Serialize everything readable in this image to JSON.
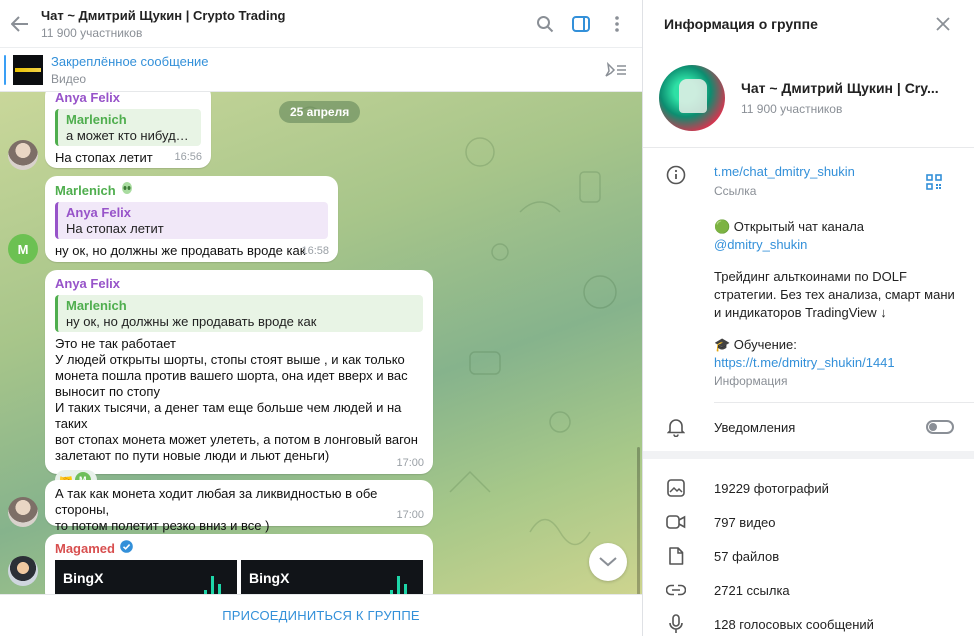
{
  "chat": {
    "title": "Чат ~ Дмитрий Щукин | Crypto Trading",
    "members": "11 900 участников",
    "pinned": {
      "title": "Закреплённое сообщение",
      "subtitle": "Видео"
    },
    "date_label": "25 апреля",
    "messages": [
      {
        "sender": "Anya Felix",
        "reply_name": "Marlenich",
        "reply_text": "а может кто нибудь о...",
        "text": "На стопах летит",
        "time": "16:56"
      },
      {
        "sender": "Marlenich",
        "sender_badge_icon": "alien-emoji-badge",
        "avatar_letter": "M",
        "reply_name": "Anya Felix",
        "reply_text": "На стопах летит",
        "text": "ну ок, но должны же продавать вроде как",
        "time": "16:58"
      },
      {
        "sender": "Anya Felix",
        "reply_name": "Marlenich",
        "reply_text": "ну ок, но должны же продавать вроде как",
        "text": "Это не так работает\nУ людей открыты шорты, стопы стоят выше , и как только\nмонета пошла против вашего шорта, она идет вверх и вас\nвыносит по стопу\nИ таких тысячи, а денег там еще больше чем людей и на таких\nвот стопах монета может улететь, а потом в лонговый вагон\nзалетают по пути новые люди и льют деньги)",
        "reaction_emoji": "🤝",
        "reaction_avatar_letter": "M",
        "time": "17:00"
      },
      {
        "text": "А так как монета ходит любая за ликвидностью в обе стороны,\nто потом полетит резко вниз и все )",
        "time": "17:00"
      },
      {
        "sender": "Magamed",
        "verified": true,
        "images": [
          "BingX",
          "BingX"
        ]
      }
    ],
    "join_label": "ПРИСОЕДИНИТЬСЯ К ГРУППЕ"
  },
  "info": {
    "title": "Информация о группе",
    "group_name": "Чат ~ Дмитрий Щукин | Cry...",
    "members": "11 900 участников",
    "link": "t.me/chat_dmitry_shukin",
    "link_label": "Ссылка",
    "desc_line1": "🟢 Открытый чат канала",
    "desc_channel": "@dmitry_shukin",
    "desc_body": "Трейдинг альткоинами по DOLF стратегии. Без тех анализа, смарт мани и индикаторов TradingView ↓",
    "desc_edu": "🎓 Обучение:",
    "desc_edu_link": "https://t.me/dmitry_shukin/1441",
    "desc_label": "Информация",
    "notifications_label": "Уведомления",
    "notifications_on": false,
    "media": [
      {
        "icon": "photo-icon",
        "label": "19229 фотографий"
      },
      {
        "icon": "video-icon",
        "label": "797 видео"
      },
      {
        "icon": "file-icon",
        "label": "57 файлов"
      },
      {
        "icon": "link-icon",
        "label": "2721 ссылка"
      },
      {
        "icon": "microphone-icon",
        "label": "128 голосовых сообщений"
      }
    ]
  },
  "colors": {
    "accent": "#3390d9",
    "green_name": "#4fae4e",
    "purple_name": "#9753c9",
    "red_name": "#d84f4f"
  }
}
